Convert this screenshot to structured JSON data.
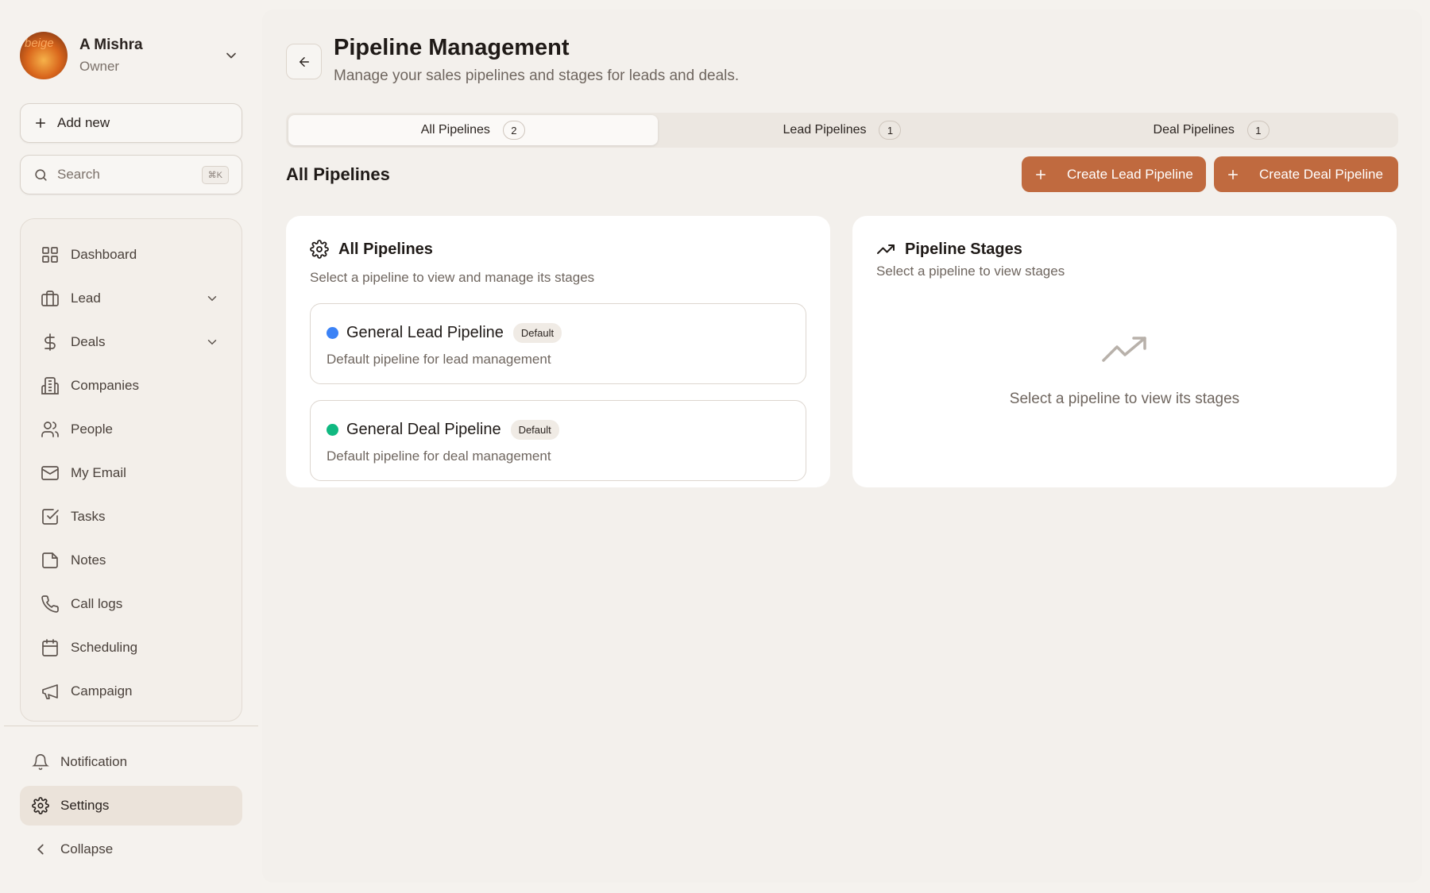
{
  "profile": {
    "name": "A Mishra",
    "role": "Owner",
    "avatar_text": "beige"
  },
  "sidebar": {
    "add_new_label": "Add new",
    "search_placeholder": "Search",
    "search_shortcut": "⌘K",
    "items": [
      {
        "label": "Dashboard",
        "icon": "dashboard-icon"
      },
      {
        "label": "Lead",
        "icon": "briefcase-icon"
      },
      {
        "label": "Deals",
        "icon": "dollar-icon"
      },
      {
        "label": "Companies",
        "icon": "building-icon"
      },
      {
        "label": "People",
        "icon": "people-icon"
      },
      {
        "label": "My Email",
        "icon": "mail-icon"
      },
      {
        "label": "Tasks",
        "icon": "checkbox-icon"
      },
      {
        "label": "Notes",
        "icon": "note-icon"
      },
      {
        "label": "Call logs",
        "icon": "phone-icon"
      },
      {
        "label": "Scheduling",
        "icon": "calendar-icon"
      },
      {
        "label": "Campaign",
        "icon": "megaphone-icon"
      }
    ],
    "bottom": {
      "notification": "Notification",
      "settings": "Settings",
      "collapse": "Collapse"
    }
  },
  "header": {
    "title": "Pipeline Management",
    "subtitle": "Manage your sales pipelines and stages for leads and deals."
  },
  "tabs": [
    {
      "label": "All Pipelines",
      "count": "2"
    },
    {
      "label": "Lead Pipelines",
      "count": "1"
    },
    {
      "label": "Deal Pipelines",
      "count": "1"
    }
  ],
  "section": {
    "title": "All Pipelines",
    "create_lead_label": "Create Lead Pipeline",
    "create_deal_label": "Create Deal Pipeline"
  },
  "pipelines_card": {
    "title": "All Pipelines",
    "subtitle": "Select a pipeline to view and manage its stages",
    "items": [
      {
        "name": "General Lead Pipeline",
        "badge": "Default",
        "description": "Default pipeline for lead management",
        "color": "#3b82f6"
      },
      {
        "name": "General Deal Pipeline",
        "badge": "Default",
        "description": "Default pipeline for deal management",
        "color": "#10b981"
      }
    ]
  },
  "stages_card": {
    "title": "Pipeline Stages",
    "subtitle": "Select a pipeline to view stages",
    "empty_text": "Select a pipeline to view its stages"
  },
  "colors": {
    "accent": "#c06a3f",
    "background": "#f5f2ee"
  }
}
